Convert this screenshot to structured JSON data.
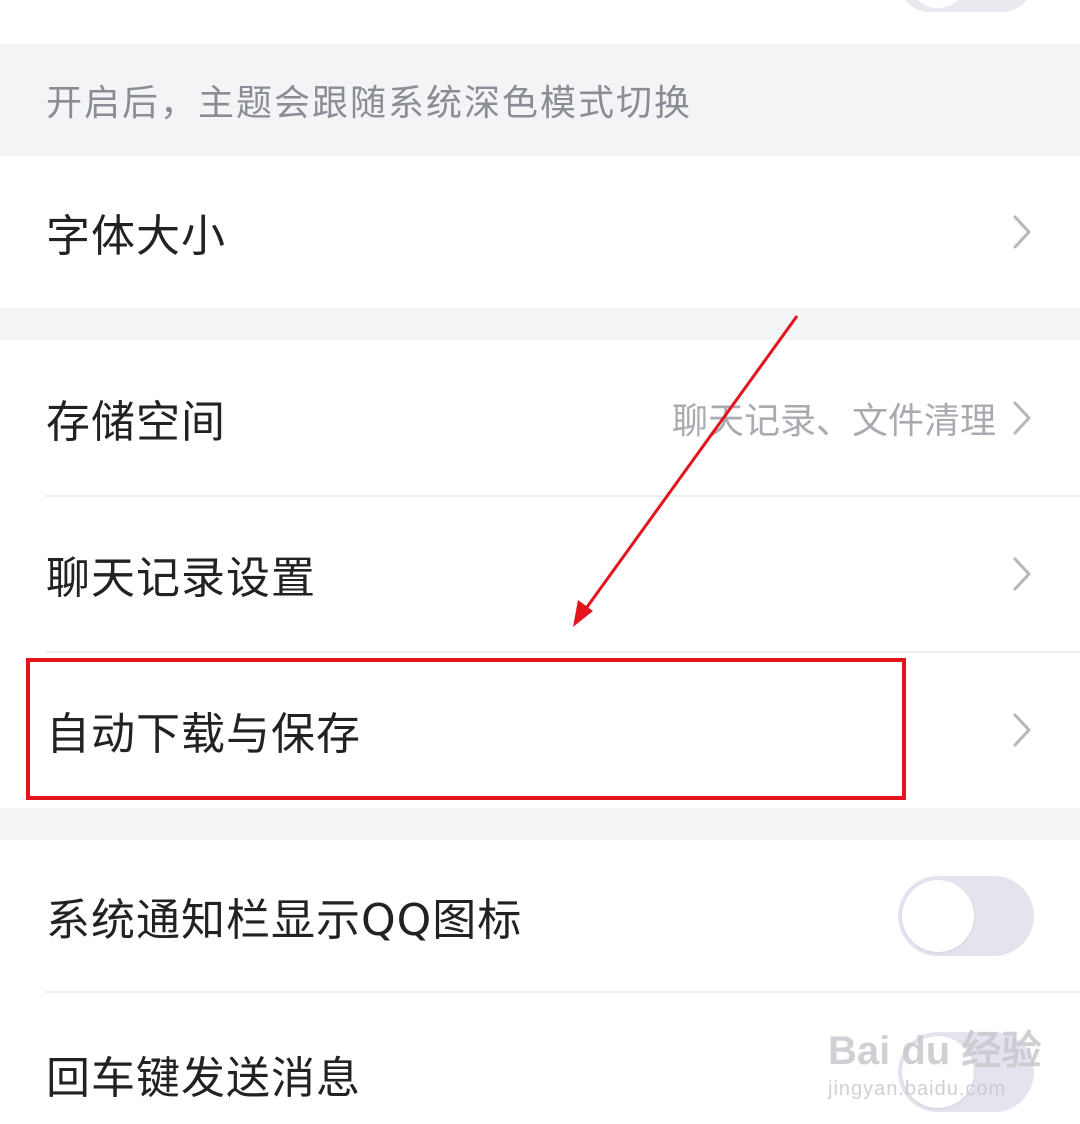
{
  "theme_hint": "开启后，主题会跟随系统深色模式切换",
  "font_size": {
    "label": "字体大小"
  },
  "storage": {
    "label": "存储空间",
    "value": "聊天记录、文件清理"
  },
  "chat_history": {
    "label": "聊天记录设置"
  },
  "auto_download": {
    "label": "自动下载与保存"
  },
  "notify_icon": {
    "label": "系统通知栏显示QQ图标",
    "enabled": false
  },
  "enter_send": {
    "label": "回车键发送消息",
    "enabled": false
  },
  "watermark": {
    "main": "Bai du 经验",
    "sub": "jingyan.baidu.com"
  },
  "colors": {
    "annotation_red": "#e3141b",
    "toggle_off": "#e3e4ee"
  },
  "icons": {
    "chevron": "chevron-right-icon"
  }
}
